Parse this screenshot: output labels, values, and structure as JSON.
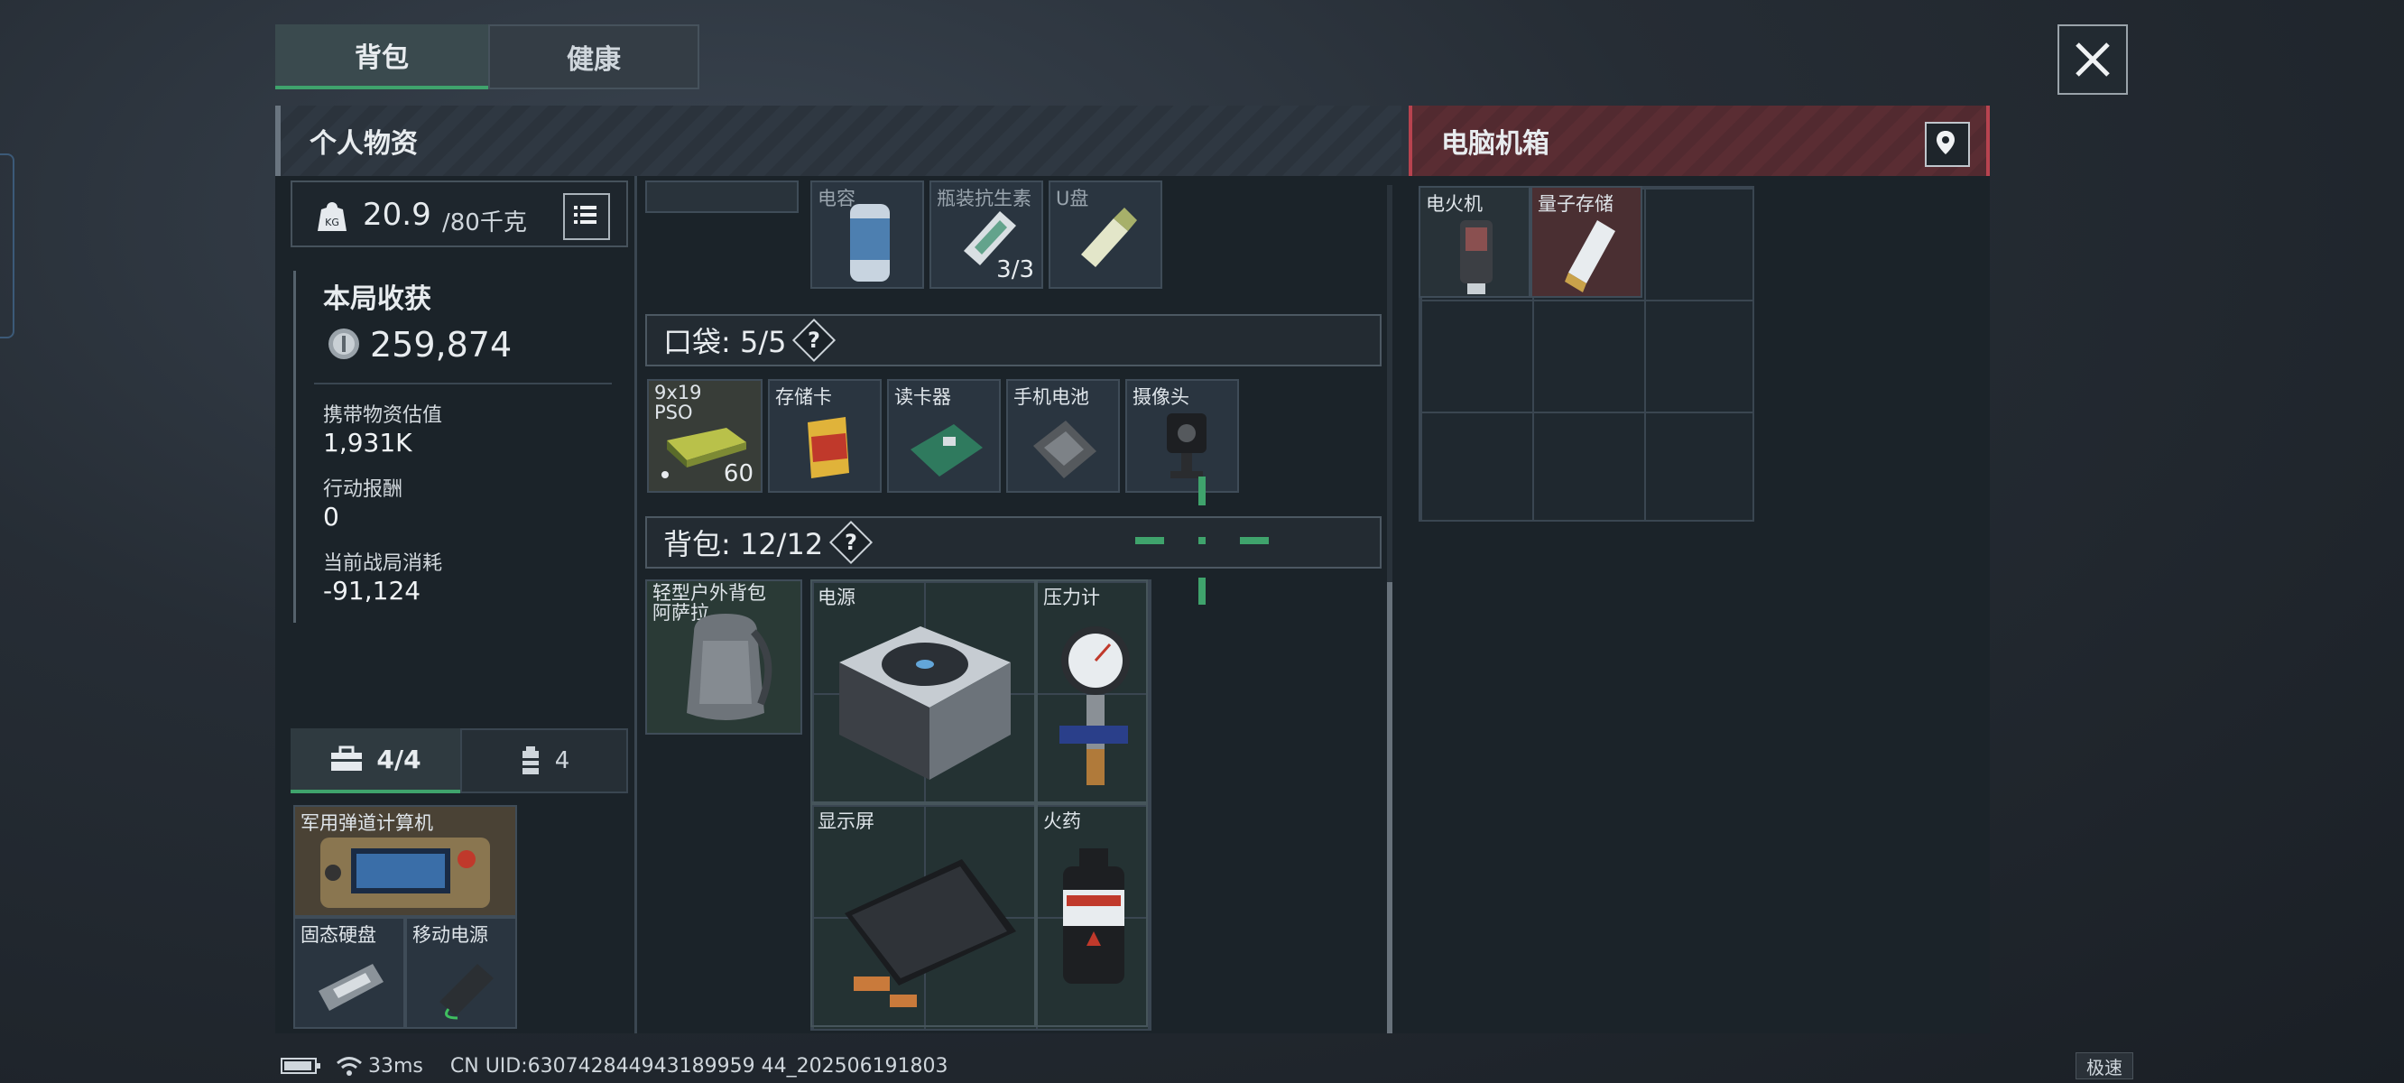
{
  "tabs": {
    "backpack": "背包",
    "health": "健康"
  },
  "left_panel": {
    "title": "个人物资"
  },
  "right_panel": {
    "title": "电脑机箱"
  },
  "weight": {
    "current": "20.9",
    "max": "/80千克",
    "icon_text": "KG"
  },
  "harvest": {
    "title": "本局收获",
    "amount": "259,874",
    "stats": [
      {
        "label": "携带物资估值",
        "value": "1,931K"
      },
      {
        "label": "行动报酬",
        "value": "0"
      },
      {
        "label": "当前战局消耗",
        "value": "-91,124"
      }
    ]
  },
  "safe_tabs": {
    "case": "4/4",
    "other": "4"
  },
  "top_items": [
    {
      "label": "电容",
      "count": ""
    },
    {
      "label": "瓶装抗生素",
      "count": "3/3"
    },
    {
      "label": "U盘",
      "count": ""
    }
  ],
  "pocket": {
    "label": "口袋: 5/5",
    "help": "?"
  },
  "pocket_items": [
    {
      "label": "9x19\nPSO",
      "count": "60"
    },
    {
      "label": "存储卡",
      "count": ""
    },
    {
      "label": "读卡器",
      "count": ""
    },
    {
      "label": "手机电池",
      "count": ""
    },
    {
      "label": "摄像头",
      "count": ""
    }
  ],
  "backpack": {
    "label": "背包: 12/12",
    "help": "?"
  },
  "backpack_items": [
    {
      "label": "轻型户外背包\n阿萨拉"
    },
    {
      "label": "电源"
    },
    {
      "label": "压力计"
    },
    {
      "label": "显示屏"
    },
    {
      "label": "火药"
    }
  ],
  "safe_items": [
    {
      "label": "军用弹道计算机"
    },
    {
      "label": "固态硬盘"
    },
    {
      "label": "移动电源"
    }
  ],
  "container_items": [
    {
      "label": "电火机"
    },
    {
      "label": "量子存储"
    }
  ],
  "status": {
    "ping": "33ms",
    "uid": "CN UID:630742844943189959 44_202506191803",
    "speed": "极速"
  },
  "colors": {
    "accent": "#3fa36c",
    "container_header": "#5a2d33",
    "panel": "#1b2329"
  }
}
